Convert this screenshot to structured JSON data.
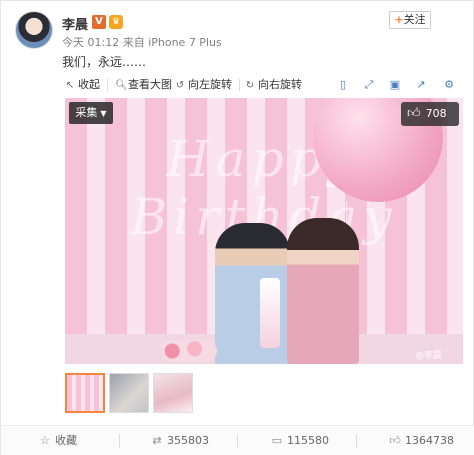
{
  "user": {
    "name": "李晨",
    "verified_badge": "V",
    "member_badge": "♛",
    "follow_label": "+关注",
    "follow_plus": "+",
    "follow_text": "关注"
  },
  "post": {
    "meta": "今天 01:12 来自 iPhone 7 Plus",
    "text": "我们，永远……"
  },
  "toolbar": {
    "collapse_label": "收起",
    "view_large_label": "查看大图",
    "rotate_left_label": "向左旋转",
    "rotate_right_label": "向右旋转"
  },
  "photo": {
    "collect_label": "采集",
    "like_count": "708",
    "watermark": "@李晨"
  },
  "actions": {
    "favorite_label": "收藏",
    "repost_count": "355803",
    "comment_count": "115580",
    "like_count": "1364738"
  },
  "icons": {
    "collapse": "arrow-left-icon",
    "view_large": "search-icon",
    "rotate_left": "rotate-left-icon",
    "rotate_right": "rotate-right-icon",
    "favorite": "star-icon",
    "repost": "repost-icon",
    "comment": "comment-icon",
    "like": "thumbs-up-icon"
  },
  "colors": {
    "accent": "#f7843f",
    "link": "#4a7fbf"
  }
}
